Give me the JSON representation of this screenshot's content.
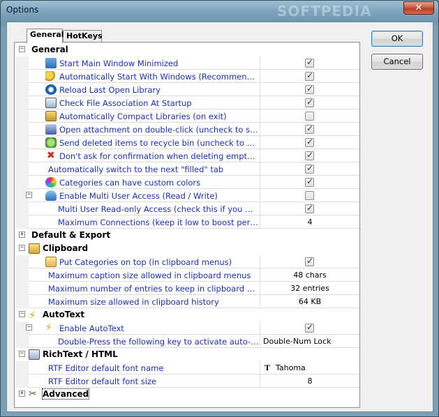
{
  "window": {
    "title": "Options",
    "watermark": "SOFTPEDIA",
    "close_label": "✕"
  },
  "tabs": [
    {
      "label": "General",
      "active": true
    },
    {
      "label": "HotKeys",
      "active": false
    }
  ],
  "buttons": {
    "ok": "OK",
    "cancel": "Cancel"
  },
  "grid": {
    "categories": [
      {
        "label": "General",
        "expanded": true
      },
      {
        "label": "Default & Export",
        "expanded": false
      },
      {
        "label": "Clipboard",
        "expanded": true
      },
      {
        "label": "AutoText",
        "expanded": true
      },
      {
        "label": "RichText / HTML",
        "expanded": true
      },
      {
        "label": "Advanced",
        "expanded": false
      }
    ],
    "general": [
      {
        "label": "Start Main Window Minimized",
        "checked": true,
        "icon": "window-icon"
      },
      {
        "label": "Automatically Start With Windows (Recommended)",
        "checked": true,
        "icon": "key-icon"
      },
      {
        "label": "Reload Last Open Library",
        "checked": true,
        "icon": "reload-icon"
      },
      {
        "label": "Check File Association At Startup",
        "checked": true,
        "icon": "file-check-icon"
      },
      {
        "label": "Automatically Compact Libraries (on exit)",
        "checked": false,
        "icon": "compact-icon"
      },
      {
        "label": "Open attachment on double-click (uncheck to save atta...",
        "checked": true,
        "icon": "attachment-icon"
      },
      {
        "label": "Send deleted items to recycle bin (uncheck to permane...",
        "checked": true,
        "icon": "recycle-icon"
      },
      {
        "label": "Don't ask for confirmation when deleting empty catego...",
        "checked": true,
        "icon": "delete-icon"
      },
      {
        "label": "Automatically switch to the next \"filled\" tab",
        "checked": true,
        "icon": ""
      },
      {
        "label": "Categories can have custom colors",
        "checked": true,
        "icon": "colors-icon"
      }
    ],
    "multi_user": {
      "label": "Enable Multi User Access (Read / Write)",
      "checked": false,
      "children": [
        {
          "label": "Multi User Read-only Access (check this if you want to s...",
          "checked": true
        },
        {
          "label": "Maximum Connections (keep it low to boost performan...",
          "value": "4"
        }
      ]
    },
    "clipboard": [
      {
        "label": "Put Categories on top (in clipboard menus)",
        "checked": true,
        "icon": "folder-icon"
      },
      {
        "label": "Maximum caption size allowed in clipboard menus",
        "value": "48 chars"
      },
      {
        "label": "Maximum number of entries to keep in clipboard history",
        "value": "32 entries"
      },
      {
        "label": "Maximum size allowed in clipboard history",
        "value": "64 KB"
      }
    ],
    "autotext": {
      "label": "Enable AutoText",
      "checked": true,
      "children": [
        {
          "label": "Double-Press the following key to activate auto-text trac...",
          "value": "Double-Num Lock"
        }
      ]
    },
    "richtext": [
      {
        "label": "RTF Editor default font name",
        "value": "Tahoma",
        "value_icon": "font-icon"
      },
      {
        "label": "RTF Editor default font size",
        "value": "8"
      }
    ]
  },
  "colors": {
    "accent": "#1a2fd0",
    "title_bar": "#7fa6be"
  }
}
